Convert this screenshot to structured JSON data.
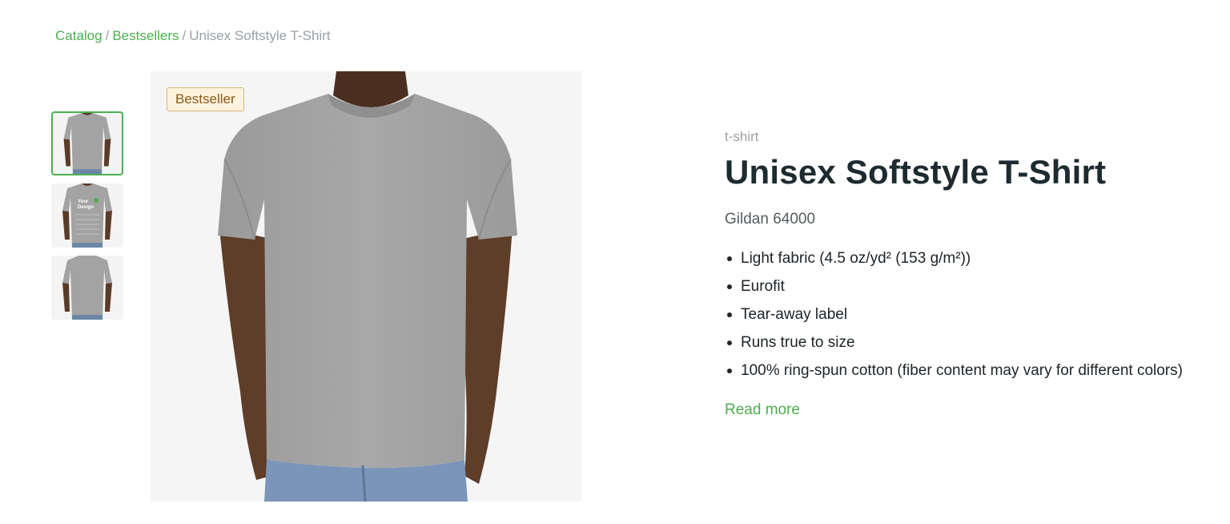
{
  "breadcrumb": {
    "items": [
      "Catalog",
      "Bestsellers"
    ],
    "separator": "/",
    "current": "Unisex Softstyle T-Shirt"
  },
  "gallery": {
    "badge": "Bestseller",
    "thumbnails": [
      {
        "icon": "tshirt-front-image",
        "selected": true
      },
      {
        "icon": "tshirt-front-design-image",
        "selected": false
      },
      {
        "icon": "tshirt-back-image",
        "selected": false
      }
    ],
    "thumbnail_design_text": [
      "Your",
      "Design"
    ]
  },
  "product": {
    "category": "t-shirt",
    "title": "Unisex Softstyle T-Shirt",
    "model": "Gildan 64000",
    "features": [
      "Light fabric (4.5 oz/yd² (153 g/m²))",
      "Eurofit",
      "Tear-away label",
      "Runs true to size",
      "100% ring-spun cotton (fiber content may vary for different colors)"
    ],
    "read_more": "Read more"
  },
  "colors": {
    "accent": "#4caf50",
    "badge_bg": "#fdf3dc",
    "badge_border": "#d9b679",
    "shirt": "#a3a3a3"
  }
}
